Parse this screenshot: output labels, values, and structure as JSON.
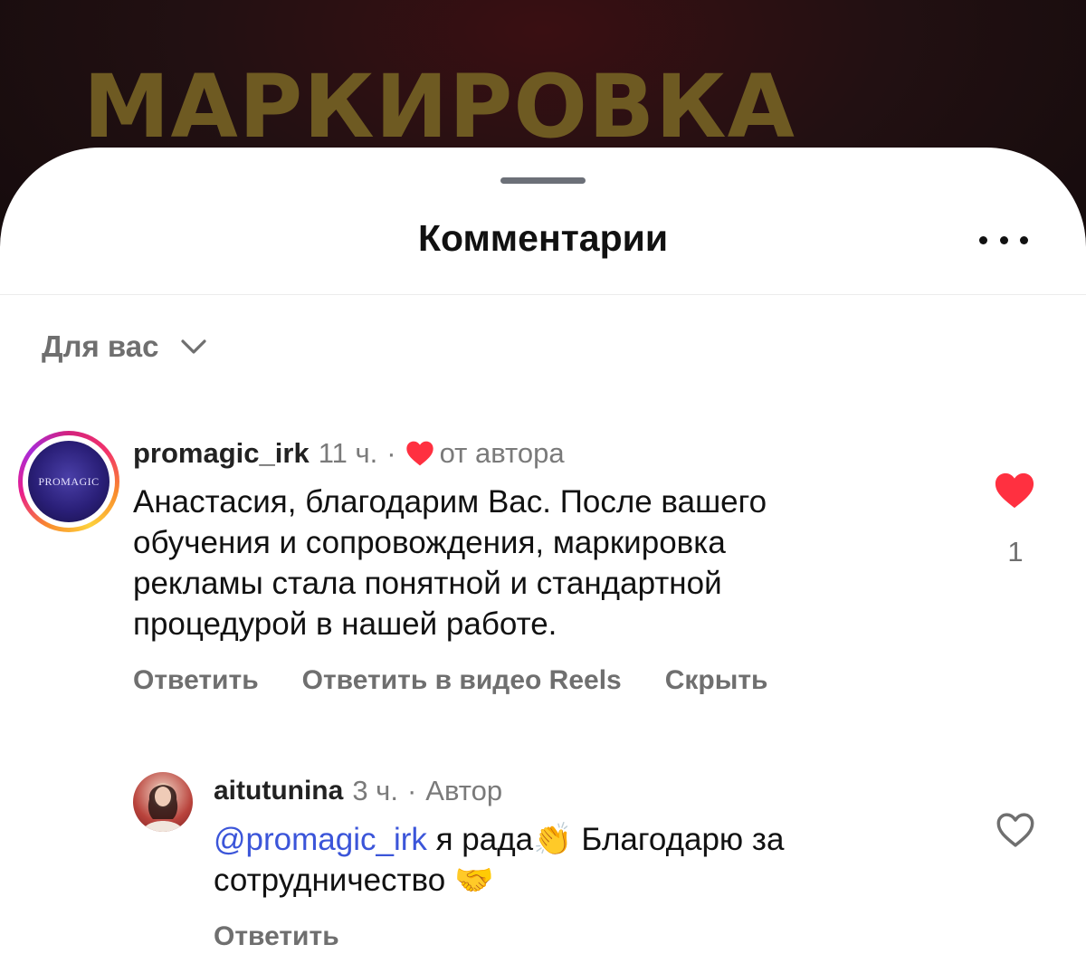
{
  "video": {
    "title": "МАРКИРОВКА"
  },
  "sheet": {
    "title": "Комментарии",
    "more_icon": "more-horizontal-icon"
  },
  "sort": {
    "label": "Для вас",
    "icon": "chevron-down-icon"
  },
  "comments": [
    {
      "username": "promagic_irk",
      "avatar_text": "PROMAGIC",
      "time": "11 ч.",
      "separator": "·",
      "author_like_label": "от автора",
      "text": "Анастасия, благодарим Вас. После вашего\nобучения и сопровождения, маркировка\nрекламы стала понятной и стандартной\nпроцедурой в нашей работе.",
      "actions": [
        "Ответить",
        "Ответить в видео Reels",
        "Скрыть"
      ],
      "like_count": "1",
      "liked": true
    }
  ],
  "reply": {
    "username": "aitutunina",
    "time": "3 ч.",
    "separator": "·",
    "badge": "Автор",
    "mention": "@promagic_irk",
    "text_part1": " я рада",
    "emoji1": "👏",
    "text_part2": " Благодарю за сотрудничество ",
    "emoji2": "🤝",
    "action": "Ответить",
    "liked": false
  },
  "colors": {
    "like": "#ff3040",
    "mention": "#3b55d9",
    "muted": "#6f6f6f"
  }
}
